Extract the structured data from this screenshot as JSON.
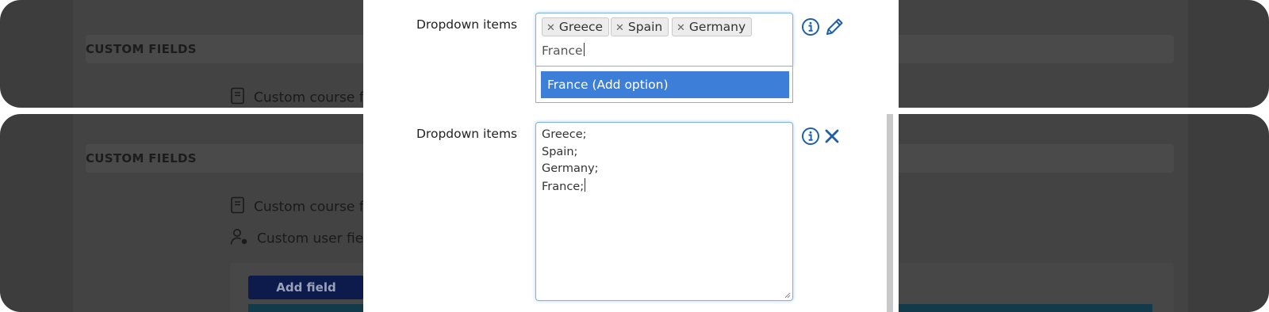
{
  "background": {
    "section_header": "CUSTOM FIELDS",
    "custom_course_label": "Custom course fields",
    "custom_user_label": "Custom user fields",
    "add_field_button": "Add field"
  },
  "top_panel": {
    "field_label": "Dropdown items",
    "tags": [
      "Greece",
      "Spain",
      "Germany"
    ],
    "input_value": "France",
    "dropdown_option": "France (Add option)",
    "info_icon": "info-icon",
    "edit_icon": "pencil-icon"
  },
  "bottom_panel": {
    "field_label": "Dropdown items",
    "textarea_lines": [
      "Greece;",
      "Spain;",
      "Germany;",
      "France;"
    ],
    "info_icon": "info-icon",
    "close_icon": "close-icon"
  },
  "colors": {
    "accent_blue": "#1f5fa8",
    "selected_option": "#3d7ed9",
    "overlay": "#3d3d3d"
  }
}
